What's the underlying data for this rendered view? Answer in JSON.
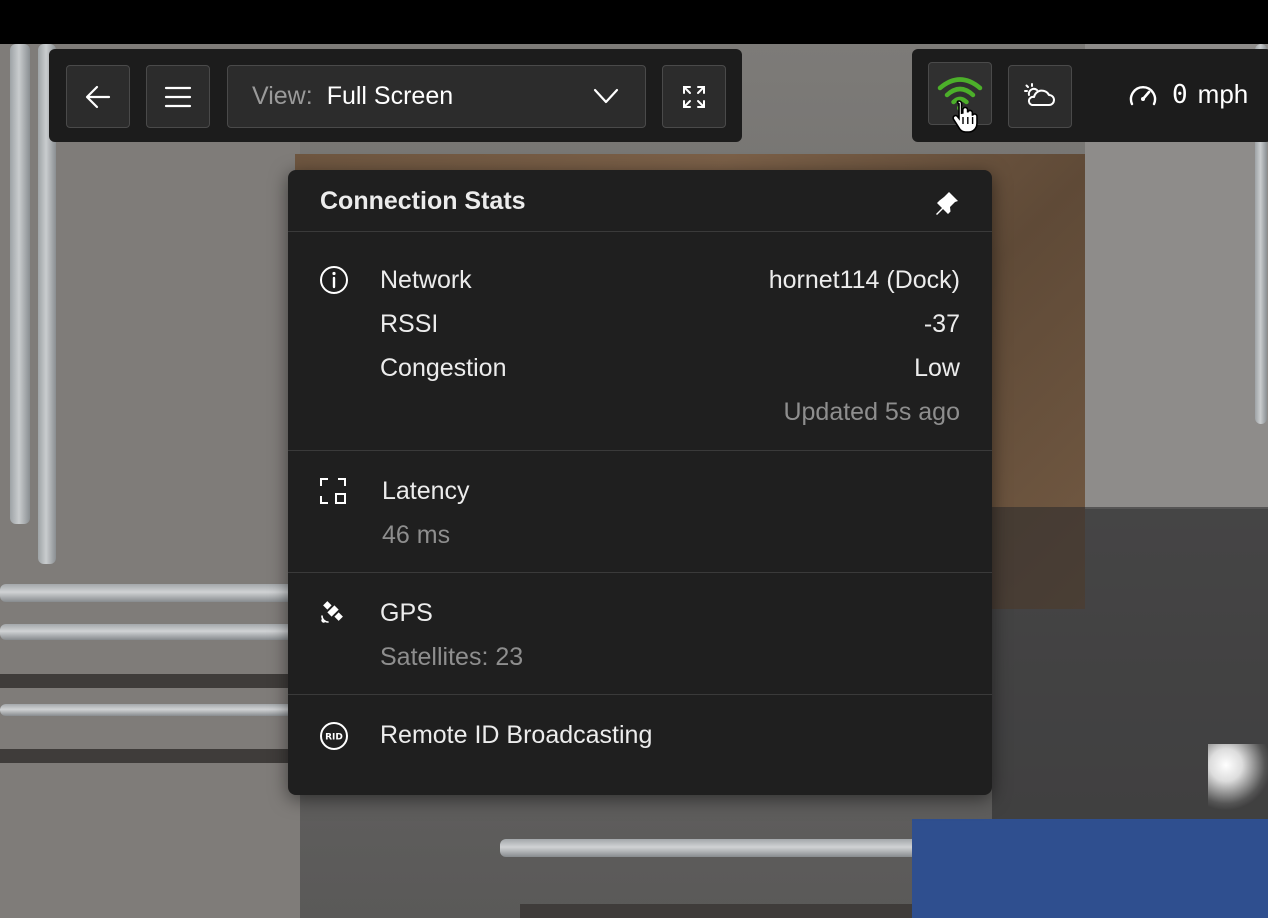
{
  "toolbar": {
    "view_prefix": "View:",
    "view_value": "Full Screen"
  },
  "status": {
    "speed_value": "0",
    "speed_unit": "mph"
  },
  "popover": {
    "title": "Connection Stats",
    "network": {
      "network_label": "Network",
      "network_value": "hornet114 (Dock)",
      "rssi_label": "RSSI",
      "rssi_value": "-37",
      "congestion_label": "Congestion",
      "congestion_value": "Low",
      "updated": "Updated 5s ago"
    },
    "latency": {
      "label": "Latency",
      "value": "46 ms"
    },
    "gps": {
      "label": "GPS",
      "value": "Satellites: 23"
    },
    "remote_id": {
      "label": "Remote ID Broadcasting"
    }
  },
  "colors": {
    "wifi_active": "#4caf2a",
    "panel_bg": "#1f1f1f",
    "toolbar_bg": "#1c1c1c"
  }
}
